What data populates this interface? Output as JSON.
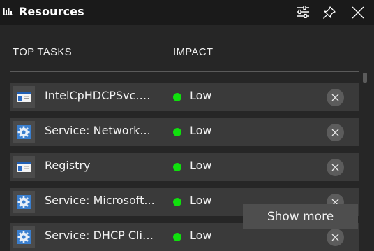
{
  "window": {
    "title": "Resources",
    "icon": "bar-chart-icon"
  },
  "toolbar": {
    "settings_icon": "sliders-icon",
    "pin_icon": "pin-icon",
    "close_icon": "close-icon"
  },
  "table": {
    "headers": {
      "tasks": "TOP TASKS",
      "impact": "IMPACT"
    },
    "rows": [
      {
        "name": "IntelCpHDCPSvc.exe",
        "icon": "app-window-icon",
        "impact": "Low"
      },
      {
        "name": "Service: Network...",
        "icon": "gear-icon",
        "impact": "Low"
      },
      {
        "name": "Registry",
        "icon": "app-window-icon",
        "impact": "Low"
      },
      {
        "name": "Service: Microsoft...",
        "icon": "gear-icon",
        "impact": "Low"
      },
      {
        "name": "Service: DHCP Clie...",
        "icon": "gear-icon",
        "impact": "Low"
      }
    ]
  },
  "show_more": {
    "label": "Show more"
  },
  "colors": {
    "impact_low": "#10e00d",
    "background": "#262626",
    "titlebar": "#1a1a1a",
    "row": "#3a3a3a"
  }
}
